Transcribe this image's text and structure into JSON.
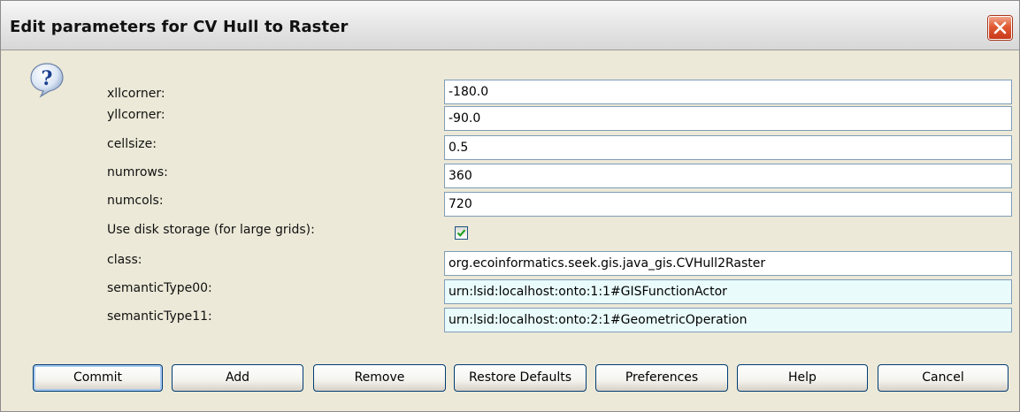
{
  "window": {
    "title": "Edit parameters for CV Hull to Raster"
  },
  "icons": {
    "close": "close-icon",
    "help": "question-mark-icon",
    "check": "checkmark-icon"
  },
  "colors": {
    "close_button": "#d8472a",
    "field_border": "#7f9db9",
    "readonly_field_bg": "#e9fbfb",
    "dialog_bg": "#ece9d8"
  },
  "params": {
    "xllcorner": {
      "label": "xllcorner:",
      "value": "-180.0"
    },
    "yllcorner": {
      "label": "yllcorner:",
      "value": "-90.0"
    },
    "cellsize": {
      "label": "cellsize:",
      "value": "0.5"
    },
    "numrows": {
      "label": "numrows:",
      "value": "360"
    },
    "numcols": {
      "label": "numcols:",
      "value": "720"
    },
    "disk_storage": {
      "label": "Use disk storage (for large grids):",
      "checked": true
    },
    "class": {
      "label": "class:",
      "value": "org.ecoinformatics.seek.gis.java_gis.CVHull2Raster"
    },
    "semanticType00": {
      "label": "semanticType00:",
      "value": "urn:lsid:localhost:onto:1:1#GISFunctionActor"
    },
    "semanticType11": {
      "label": "semanticType11:",
      "value": "urn:lsid:localhost:onto:2:1#GeometricOperation"
    }
  },
  "buttons": {
    "commit": "Commit",
    "add": "Add",
    "remove": "Remove",
    "restore_defaults": "Restore Defaults",
    "preferences": "Preferences",
    "help": "Help",
    "cancel": "Cancel"
  }
}
